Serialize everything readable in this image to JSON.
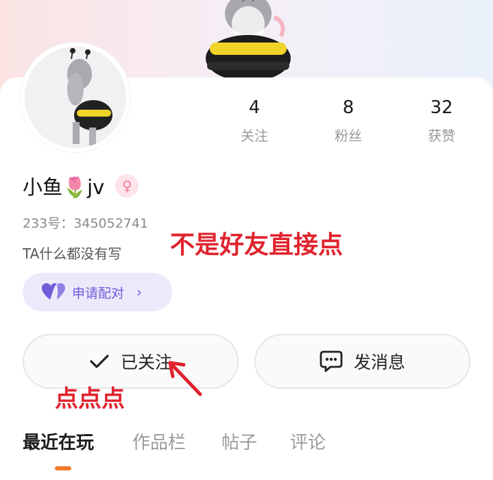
{
  "profile": {
    "username": "小鱼🌷jv",
    "gender_symbol": "♀",
    "uid_text": "233号：345052741",
    "bio": "TA什么都没有写"
  },
  "stats": [
    {
      "value": "4",
      "label": "关注"
    },
    {
      "value": "8",
      "label": "粉丝"
    },
    {
      "value": "32",
      "label": "获赞"
    }
  ],
  "pair_button": {
    "label": "申请配对",
    "chevron": "›"
  },
  "actions": {
    "follow_label": "已关注",
    "message_label": "发消息"
  },
  "tabs": [
    {
      "label": "最近在玩",
      "active": true
    },
    {
      "label": "作品栏",
      "active": false
    },
    {
      "label": "帖子",
      "active": false
    },
    {
      "label": "评论",
      "active": false
    }
  ],
  "annotations": {
    "top_note": "不是好友直接点",
    "bottom_note": "点点点",
    "color": "#e0232e"
  },
  "colors": {
    "accent_purple": "#6f5ddb",
    "tab_indicator": "#f37a2a",
    "gender_pink": "#f07a98"
  },
  "icons": {
    "gender": "female-icon",
    "pair": "heart-icon",
    "follow": "check-icon",
    "message": "chat-bubble-icon"
  }
}
